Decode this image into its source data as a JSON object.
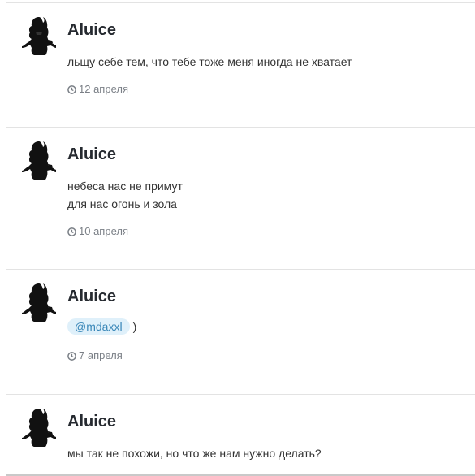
{
  "posts": [
    {
      "author": "Aluice",
      "lines": [
        "льщу себе тем, что тебе тоже меня иногда не хватает"
      ],
      "date": "12 апреля",
      "avatar_icon": "goth-character-silhouette-icon"
    },
    {
      "author": "Aluice",
      "lines": [
        "небеса нас не примут",
        "для нас огонь и зола"
      ],
      "date": "10 апреля",
      "avatar_icon": "goth-character-silhouette-icon"
    },
    {
      "author": "Aluice",
      "mention": "@mdaxxl",
      "after_mention": ")",
      "date": "7 апреля",
      "avatar_icon": "goth-character-silhouette-icon"
    },
    {
      "author": "Aluice",
      "lines": [
        "мы так не похожи, но что же нам нужно делать?"
      ],
      "avatar_icon": "goth-character-silhouette-icon"
    }
  ],
  "colors": {
    "mention_bg": "#dff0fa",
    "mention_text": "#3a87b8",
    "date_text": "#7a7f86"
  }
}
